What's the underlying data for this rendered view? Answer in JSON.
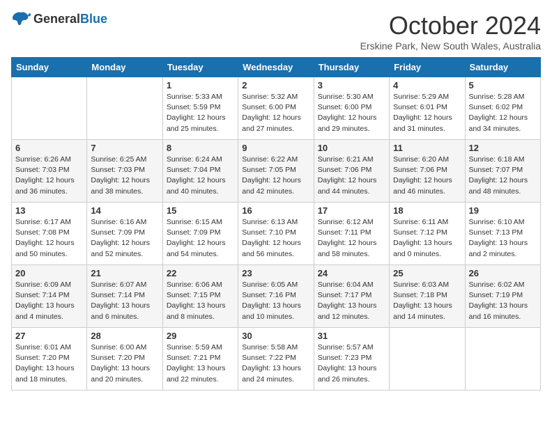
{
  "logo": {
    "general": "General",
    "blue": "Blue"
  },
  "header": {
    "month": "October 2024",
    "location": "Erskine Park, New South Wales, Australia"
  },
  "days_of_week": [
    "Sunday",
    "Monday",
    "Tuesday",
    "Wednesday",
    "Thursday",
    "Friday",
    "Saturday"
  ],
  "weeks": [
    [
      {
        "day": "",
        "sunrise": "",
        "sunset": "",
        "daylight": ""
      },
      {
        "day": "",
        "sunrise": "",
        "sunset": "",
        "daylight": ""
      },
      {
        "day": "1",
        "sunrise": "Sunrise: 5:33 AM",
        "sunset": "Sunset: 5:59 PM",
        "daylight": "Daylight: 12 hours and 25 minutes."
      },
      {
        "day": "2",
        "sunrise": "Sunrise: 5:32 AM",
        "sunset": "Sunset: 6:00 PM",
        "daylight": "Daylight: 12 hours and 27 minutes."
      },
      {
        "day": "3",
        "sunrise": "Sunrise: 5:30 AM",
        "sunset": "Sunset: 6:00 PM",
        "daylight": "Daylight: 12 hours and 29 minutes."
      },
      {
        "day": "4",
        "sunrise": "Sunrise: 5:29 AM",
        "sunset": "Sunset: 6:01 PM",
        "daylight": "Daylight: 12 hours and 31 minutes."
      },
      {
        "day": "5",
        "sunrise": "Sunrise: 5:28 AM",
        "sunset": "Sunset: 6:02 PM",
        "daylight": "Daylight: 12 hours and 34 minutes."
      }
    ],
    [
      {
        "day": "6",
        "sunrise": "Sunrise: 6:26 AM",
        "sunset": "Sunset: 7:03 PM",
        "daylight": "Daylight: 12 hours and 36 minutes."
      },
      {
        "day": "7",
        "sunrise": "Sunrise: 6:25 AM",
        "sunset": "Sunset: 7:03 PM",
        "daylight": "Daylight: 12 hours and 38 minutes."
      },
      {
        "day": "8",
        "sunrise": "Sunrise: 6:24 AM",
        "sunset": "Sunset: 7:04 PM",
        "daylight": "Daylight: 12 hours and 40 minutes."
      },
      {
        "day": "9",
        "sunrise": "Sunrise: 6:22 AM",
        "sunset": "Sunset: 7:05 PM",
        "daylight": "Daylight: 12 hours and 42 minutes."
      },
      {
        "day": "10",
        "sunrise": "Sunrise: 6:21 AM",
        "sunset": "Sunset: 7:06 PM",
        "daylight": "Daylight: 12 hours and 44 minutes."
      },
      {
        "day": "11",
        "sunrise": "Sunrise: 6:20 AM",
        "sunset": "Sunset: 7:06 PM",
        "daylight": "Daylight: 12 hours and 46 minutes."
      },
      {
        "day": "12",
        "sunrise": "Sunrise: 6:18 AM",
        "sunset": "Sunset: 7:07 PM",
        "daylight": "Daylight: 12 hours and 48 minutes."
      }
    ],
    [
      {
        "day": "13",
        "sunrise": "Sunrise: 6:17 AM",
        "sunset": "Sunset: 7:08 PM",
        "daylight": "Daylight: 12 hours and 50 minutes."
      },
      {
        "day": "14",
        "sunrise": "Sunrise: 6:16 AM",
        "sunset": "Sunset: 7:09 PM",
        "daylight": "Daylight: 12 hours and 52 minutes."
      },
      {
        "day": "15",
        "sunrise": "Sunrise: 6:15 AM",
        "sunset": "Sunset: 7:09 PM",
        "daylight": "Daylight: 12 hours and 54 minutes."
      },
      {
        "day": "16",
        "sunrise": "Sunrise: 6:13 AM",
        "sunset": "Sunset: 7:10 PM",
        "daylight": "Daylight: 12 hours and 56 minutes."
      },
      {
        "day": "17",
        "sunrise": "Sunrise: 6:12 AM",
        "sunset": "Sunset: 7:11 PM",
        "daylight": "Daylight: 12 hours and 58 minutes."
      },
      {
        "day": "18",
        "sunrise": "Sunrise: 6:11 AM",
        "sunset": "Sunset: 7:12 PM",
        "daylight": "Daylight: 13 hours and 0 minutes."
      },
      {
        "day": "19",
        "sunrise": "Sunrise: 6:10 AM",
        "sunset": "Sunset: 7:13 PM",
        "daylight": "Daylight: 13 hours and 2 minutes."
      }
    ],
    [
      {
        "day": "20",
        "sunrise": "Sunrise: 6:09 AM",
        "sunset": "Sunset: 7:14 PM",
        "daylight": "Daylight: 13 hours and 4 minutes."
      },
      {
        "day": "21",
        "sunrise": "Sunrise: 6:07 AM",
        "sunset": "Sunset: 7:14 PM",
        "daylight": "Daylight: 13 hours and 6 minutes."
      },
      {
        "day": "22",
        "sunrise": "Sunrise: 6:06 AM",
        "sunset": "Sunset: 7:15 PM",
        "daylight": "Daylight: 13 hours and 8 minutes."
      },
      {
        "day": "23",
        "sunrise": "Sunrise: 6:05 AM",
        "sunset": "Sunset: 7:16 PM",
        "daylight": "Daylight: 13 hours and 10 minutes."
      },
      {
        "day": "24",
        "sunrise": "Sunrise: 6:04 AM",
        "sunset": "Sunset: 7:17 PM",
        "daylight": "Daylight: 13 hours and 12 minutes."
      },
      {
        "day": "25",
        "sunrise": "Sunrise: 6:03 AM",
        "sunset": "Sunset: 7:18 PM",
        "daylight": "Daylight: 13 hours and 14 minutes."
      },
      {
        "day": "26",
        "sunrise": "Sunrise: 6:02 AM",
        "sunset": "Sunset: 7:19 PM",
        "daylight": "Daylight: 13 hours and 16 minutes."
      }
    ],
    [
      {
        "day": "27",
        "sunrise": "Sunrise: 6:01 AM",
        "sunset": "Sunset: 7:20 PM",
        "daylight": "Daylight: 13 hours and 18 minutes."
      },
      {
        "day": "28",
        "sunrise": "Sunrise: 6:00 AM",
        "sunset": "Sunset: 7:20 PM",
        "daylight": "Daylight: 13 hours and 20 minutes."
      },
      {
        "day": "29",
        "sunrise": "Sunrise: 5:59 AM",
        "sunset": "Sunset: 7:21 PM",
        "daylight": "Daylight: 13 hours and 22 minutes."
      },
      {
        "day": "30",
        "sunrise": "Sunrise: 5:58 AM",
        "sunset": "Sunset: 7:22 PM",
        "daylight": "Daylight: 13 hours and 24 minutes."
      },
      {
        "day": "31",
        "sunrise": "Sunrise: 5:57 AM",
        "sunset": "Sunset: 7:23 PM",
        "daylight": "Daylight: 13 hours and 26 minutes."
      },
      {
        "day": "",
        "sunrise": "",
        "sunset": "",
        "daylight": ""
      },
      {
        "day": "",
        "sunrise": "",
        "sunset": "",
        "daylight": ""
      }
    ]
  ]
}
